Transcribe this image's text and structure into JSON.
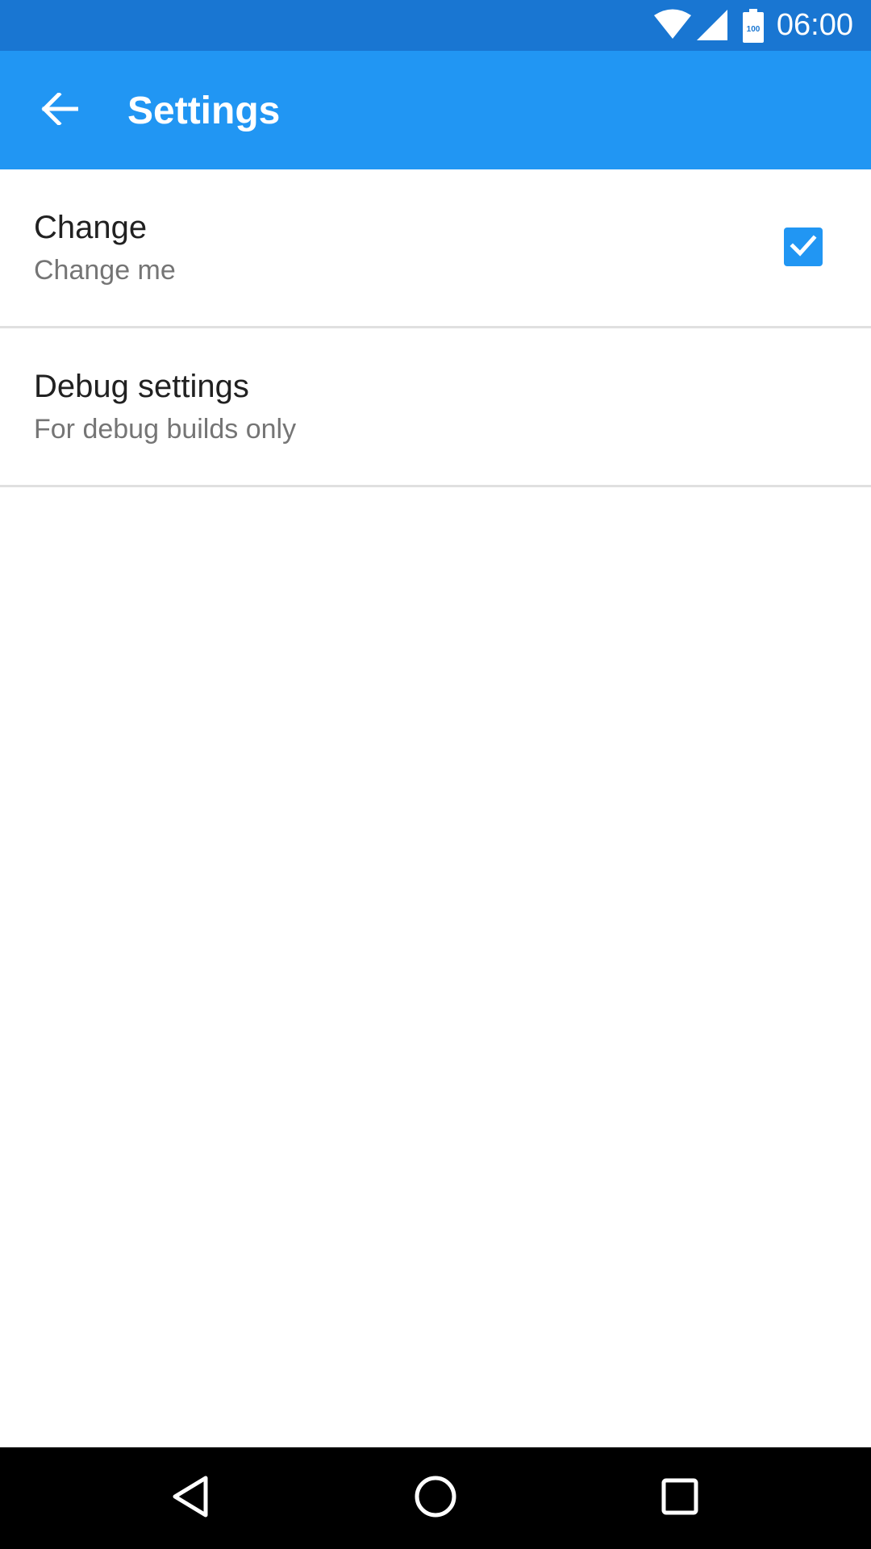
{
  "status_bar": {
    "time": "06:00",
    "battery_level": "100",
    "icons": [
      "wifi-icon",
      "cell-signal-icon",
      "battery-icon"
    ],
    "background_color": "#1976D2"
  },
  "app_bar": {
    "title": "Settings",
    "back_icon": "arrow-back-icon",
    "background_color": "#2196F3"
  },
  "preferences": [
    {
      "title": "Change",
      "summary": "Change me",
      "checked": true
    },
    {
      "title": "Debug settings",
      "summary": "For debug builds only"
    }
  ],
  "nav_bar": {
    "buttons": [
      "back-triangle-icon",
      "home-circle-icon",
      "recents-square-icon"
    ]
  },
  "colors": {
    "accent": "#2196F3",
    "primary_dark": "#1976D2",
    "divider": "#e0e0e0",
    "title_text": "#212121",
    "summary_text": "#757575"
  }
}
